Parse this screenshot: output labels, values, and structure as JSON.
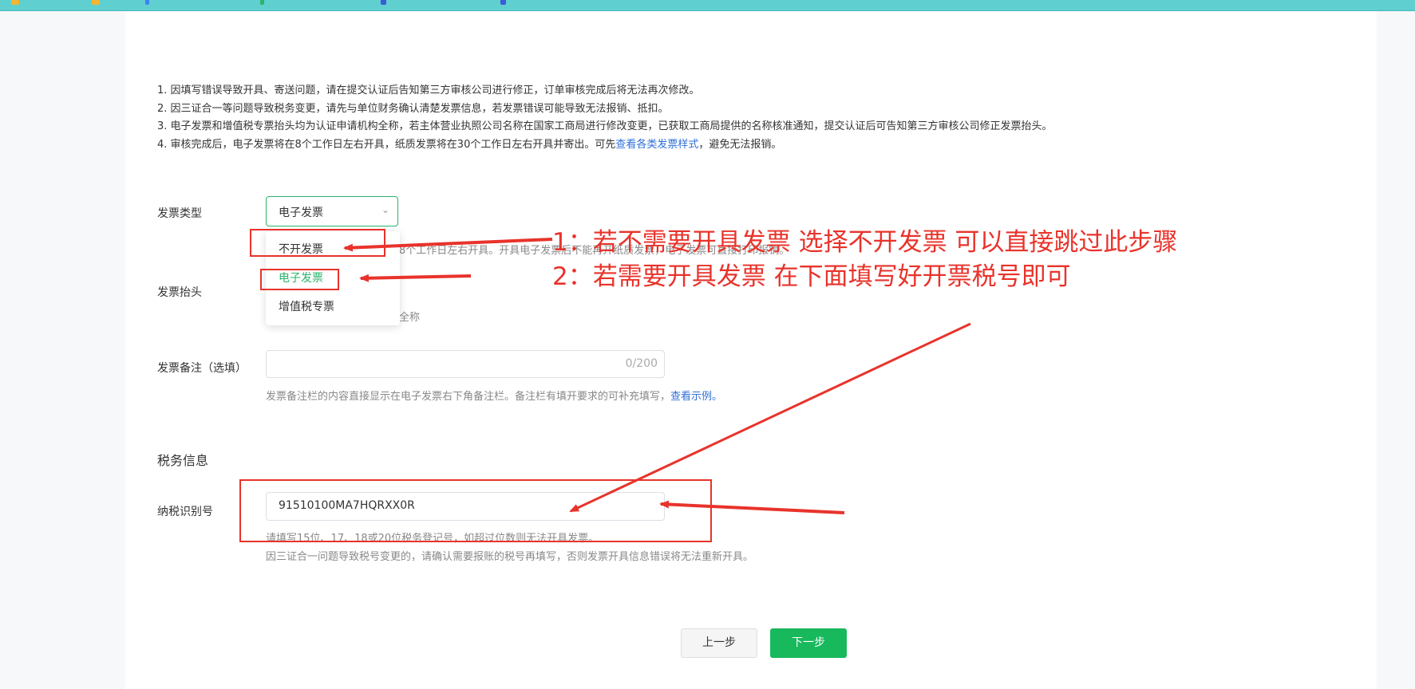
{
  "notice": [
    "1. 因填写错误导致开具、寄送问题，请在提交认证后告知第三方审核公司进行修正，订单审核完成后将无法再次修改。",
    "2. 因三证合一等问题导致税务变更，请先与单位财务确认清楚发票信息，若发票错误可能导致无法报销、抵扣。",
    "3. 电子发票和增值税专票抬头均为认证申请机构全称，若主体营业执照公司名称在国家工商局进行修改变更，已获取工商局提供的名称核准通知，提交认证后可告知第三方审核公司修正发票抬头。",
    {
      "before": "4. 审核完成后，电子发票将在8个工作日左右开具，纸质发票将在30个工作日左右开具并寄出。可先",
      "link": "查看各类发票样式",
      "after": "，避免无法报销。"
    }
  ],
  "invoice_type": {
    "label": "发票类型",
    "selected": "电子发票",
    "options": [
      "不开发票",
      "电子发票",
      "增值税专票"
    ],
    "active_option": "电子发票",
    "hint_partial": "8个工作日左右开具。开具电子发票后不能再开纸质发票，电子发票可直接打印报销。"
  },
  "invoice_title": {
    "label": "发票抬头",
    "hint_partial": "全称"
  },
  "remark": {
    "label": "发票备注（选填）",
    "counter": "0/200",
    "hint": "发票备注栏的内容直接显示在电子发票右下角备注栏。备注栏有填开要求的可补充填写，",
    "hint_link": "查看示例。"
  },
  "tax_section": {
    "title": "税务信息",
    "label": "纳税识别号",
    "value": "91510100MA7HQRXX0R",
    "hint1": "请填写15位、17、18或20位税务登记号，如超过位数则无法开具发票。",
    "hint2": "因三证合一问题导致税号变更的，请确认需要报账的税号再填写，否则发票开具信息错误将无法重新开具。"
  },
  "buttons": {
    "prev": "上一步",
    "next": "下一步"
  },
  "annotations": {
    "line1": "1：若不需要开具发票 选择不开发票  可以直接跳过此步骤",
    "line2": "2：若需要开具发票 在下面填写好开票税号即可",
    "color": "#e8332b"
  },
  "colors": {
    "accent": "#2bb36b",
    "button": "#18b85c",
    "topbar": "#5fcfcf",
    "link": "#2f6fd8"
  }
}
